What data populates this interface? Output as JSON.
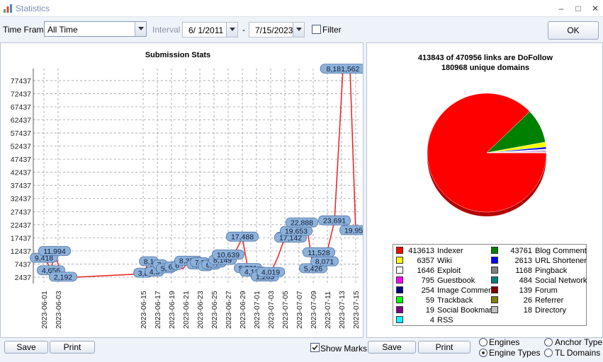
{
  "window": {
    "title": "Statistics",
    "icon": "chart-icon",
    "controls": [
      "–",
      "□",
      "✕"
    ]
  },
  "toolbar": {
    "timeframe_label": "Time Frame",
    "timeframe_value": "All Time",
    "interval_label": "Interval",
    "date_from": "6/  1/2011",
    "date_sep": "-",
    "date_to": "7/15/2023",
    "filter_label": "Filter",
    "filter_checked": false,
    "ok_label": "OK"
  },
  "chart_data": [
    {
      "type": "line",
      "title": "Submission Stats",
      "series_color": "#ee1d1d",
      "y_ticks": [
        2437,
        7437,
        12437,
        17437,
        22437,
        27437,
        32437,
        37437,
        42437,
        47437,
        52437,
        57437,
        62437,
        67437,
        72437,
        77437
      ],
      "ylim": [
        0,
        82000
      ],
      "x_tick_labels": [
        "2023-06-01",
        "2023-06-03",
        "2023-06-15",
        "2023-06-17",
        "2023-06-19",
        "2023-06-21",
        "2023-06-23",
        "2023-06-25",
        "2023-06-27",
        "2023-06-29",
        "2023-07-01",
        "2023-07-03",
        "2023-07-05",
        "2023-07-07",
        "2023-07-09",
        "2023-07-11",
        "2023-07-13",
        "2023-07-15"
      ],
      "x_tick_days": [
        0,
        2,
        14,
        16,
        18,
        20,
        22,
        24,
        26,
        28,
        30,
        32,
        34,
        36,
        38,
        40,
        42,
        44
      ],
      "xlim": [
        -1.5,
        44.5
      ],
      "points": [
        {
          "day": 0,
          "value": 9418,
          "label": "9,418"
        },
        {
          "day": 0.5,
          "value": 7890,
          "label": ""
        },
        {
          "day": 1,
          "value": 4656,
          "label": "4,656"
        },
        {
          "day": 1.5,
          "value": 11994,
          "label": "11,994"
        },
        {
          "day": 2,
          "value": 7500,
          "label": ""
        },
        {
          "day": 2.7,
          "value": 2192,
          "label": "2,192"
        },
        {
          "day": 14,
          "value": 3700,
          "label": "3,8"
        },
        {
          "day": 14.8,
          "value": 8100,
          "label": "8,1"
        },
        {
          "day": 15.6,
          "value": 4200,
          "label": "4,3"
        },
        {
          "day": 16.4,
          "value": 6900,
          "label": "7,"
        },
        {
          "day": 17.2,
          "value": 5400,
          "label": "5,6"
        },
        {
          "day": 18,
          "value": 6100,
          "label": "6,"
        },
        {
          "day": 18.8,
          "value": 6600,
          "label": "6"
        },
        {
          "day": 19.6,
          "value": 5600,
          "label": ""
        },
        {
          "day": 20.4,
          "value": 8300,
          "label": "8,373"
        },
        {
          "day": 21.2,
          "value": 6900,
          "label": "7,"
        },
        {
          "day": 22,
          "value": 7700,
          "label": "7,7"
        },
        {
          "day": 22.8,
          "value": 6200,
          "label": "6,"
        },
        {
          "day": 23.6,
          "value": 6800,
          "label": "6,4"
        },
        {
          "day": 24.4,
          "value": 7600,
          "label": "7,4"
        },
        {
          "day": 25.2,
          "value": 8600,
          "label": "8,149"
        },
        {
          "day": 26,
          "value": 10639,
          "label": "10,639"
        },
        {
          "day": 27,
          "value": 12000,
          "label": ""
        },
        {
          "day": 28,
          "value": 17488,
          "label": "17,488"
        },
        {
          "day": 28.8,
          "value": 5501,
          "label": "5,501"
        },
        {
          "day": 29.6,
          "value": 4134,
          "label": "4,134"
        },
        {
          "day": 30.4,
          "value": 3300,
          "label": ""
        },
        {
          "day": 31.2,
          "value": 2263,
          "label": "1,263"
        },
        {
          "day": 32,
          "value": 4019,
          "label": "4,019"
        },
        {
          "day": 33,
          "value": 10000,
          "label": ""
        },
        {
          "day": 34,
          "value": 17500,
          "label": "17,"
        },
        {
          "day": 34.8,
          "value": 17142,
          "label": "17,142"
        },
        {
          "day": 35.6,
          "value": 19653,
          "label": "19,653"
        },
        {
          "day": 36.4,
          "value": 22888,
          "label": "22,888"
        },
        {
          "day": 37.2,
          "value": 20000,
          "label": ""
        },
        {
          "day": 38,
          "value": 5426,
          "label": "5,426"
        },
        {
          "day": 38.8,
          "value": 11528,
          "label": "11,528"
        },
        {
          "day": 39.6,
          "value": 8071,
          "label": "8,071"
        },
        {
          "day": 41,
          "value": 23691,
          "label": "23,691"
        },
        {
          "day": 42.2,
          "value": 81562,
          "label": "8,181,562"
        },
        {
          "day": 43.2,
          "value": 81562,
          "label": ""
        },
        {
          "day": 44,
          "value": 19955,
          "label": "19,955"
        }
      ]
    },
    {
      "type": "pie",
      "title_line1": "413843 of 470956 links are DoFollow",
      "title_line2": "180968 unique domains",
      "slices": [
        {
          "label": "Indexer",
          "value": 413613,
          "color": "#ff0000"
        },
        {
          "label": "Blog Comment",
          "value": 43761,
          "color": "#008000"
        },
        {
          "label": "Wiki",
          "value": 6357,
          "color": "#ffff00"
        },
        {
          "label": "URL Shortener",
          "value": 2613,
          "color": "#0000ff"
        },
        {
          "label": "Exploit",
          "value": 1646,
          "color": "#ffffff"
        },
        {
          "label": "Pingback",
          "value": 1168,
          "color": "#808080"
        },
        {
          "label": "Guestbook",
          "value": 795,
          "color": "#ff00ff"
        },
        {
          "label": "Social Network",
          "value": 484,
          "color": "#008080"
        },
        {
          "label": "Image Comment",
          "value": 254,
          "color": "#000080"
        },
        {
          "label": "Forum",
          "value": 139,
          "color": "#800000"
        },
        {
          "label": "Trackback",
          "value": 59,
          "color": "#00ff00"
        },
        {
          "label": "Referrer",
          "value": 26,
          "color": "#808000"
        },
        {
          "label": "Social Bookmark",
          "value": 19,
          "color": "#800080"
        },
        {
          "label": "Directory",
          "value": 18,
          "color": "#c0c0c0"
        },
        {
          "label": "RSS",
          "value": 4,
          "color": "#00ffff"
        }
      ]
    }
  ],
  "bottom": {
    "save_left": "Save",
    "print_left": "Print",
    "show_marks_label": "Show Marks",
    "show_marks_checked": true,
    "save_right": "Save",
    "print_right": "Print",
    "radio_engines": "Engines",
    "radio_engine_types": "Engine Types",
    "radio_anchor_type": "Anchor Type",
    "radio_tl_domains": "TL Domains",
    "selected_radio": "Engine Types"
  }
}
